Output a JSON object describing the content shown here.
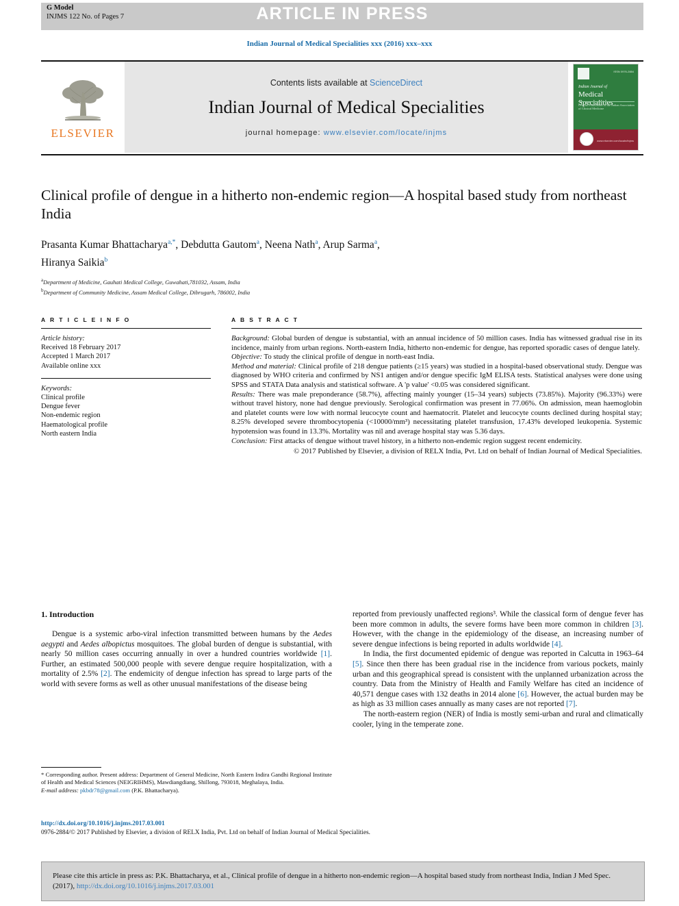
{
  "topbar": {
    "g_model": "G Model",
    "model_id": "INJMS 122 No. of Pages 7",
    "article_in_press": "ARTICLE IN PRESS"
  },
  "running_head": "Indian Journal of Medical Specialities xxx (2016) xxx–xxx",
  "masthead": {
    "publisher_name": "ELSEVIER",
    "contents_prefix": "Contents lists available at ",
    "contents_link": "ScienceDirect",
    "journal_title": "Indian Journal of Medical Specialities",
    "homepage_label": "journal homepage: ",
    "homepage_url": "www.elsevier.com/locate/injms",
    "cover": {
      "small_title": "Indian Journal of",
      "large_title": "Medical Specialities",
      "subtitle": "Official Publication of the Indian Association of Clinical Medicine",
      "issn_text": "ISSN 0976-2884",
      "band_text": "www.elsevier.com/locate/injms"
    }
  },
  "article": {
    "title": "Clinical profile of dengue in a hitherto non-endemic region—A hospital based study from northeast India",
    "authors": [
      {
        "name": "Prasanta Kumar Bhattacharya",
        "marks": "a,*"
      },
      {
        "name": "Debdutta Gautom",
        "marks": "a"
      },
      {
        "name": "Neena Nath",
        "marks": "a"
      },
      {
        "name": "Arup Sarma",
        "marks": "a"
      },
      {
        "name": "Hiranya Saikia",
        "marks": "b"
      }
    ],
    "affiliations": [
      {
        "mark": "a",
        "text": "Department of Medicine, Gauhati Medical College, Guwahati,781032, Assam, India"
      },
      {
        "mark": "b",
        "text": "Department of Community Medicine, Assam Medical College, Dibrugarh, 786002, India"
      }
    ]
  },
  "article_info": {
    "heading": "A R T I C L E  I N F O",
    "history_label": "Article history:",
    "history": [
      "Received 18 February 2017",
      "Accepted 1 March 2017",
      "Available online xxx"
    ],
    "keywords_label": "Keywords:",
    "keywords": [
      "Clinical profile",
      "Dengue fever",
      "Non-endemic region",
      "Haematological profile",
      "North eastern India"
    ]
  },
  "abstract": {
    "heading": "A B S T R A C T",
    "background_label": "Background:",
    "background": " Global burden of dengue is substantial, with an annual incidence of 50 million cases. India has witnessed gradual rise in its incidence, mainly from urban regions. North-eastern India, hitherto non-endemic for dengue, has reported sporadic cases of dengue lately.",
    "objective_label": "Objective:",
    "objective": " To study the clinical profile of dengue in north-east India.",
    "method_label": "Method and material:",
    "method": " Clinical profile of 218 dengue patients (≥15 years) was studied in a hospital-based observational study. Dengue was diagnosed by WHO criteria and confirmed by NS1 antigen and/or dengue specific IgM ELISA tests. Statistical analyses were done using SPSS and STATA Data analysis and statistical software. A 'p value' <0.05 was considered significant.",
    "results_label": "Results:",
    "results": " There was male preponderance (58.7%), affecting mainly younger (15–34 years) subjects (73.85%). Majority (96.33%) were without travel history, none had dengue previously. Serological confirmation was present in 77.06%. On admission, mean haemoglobin and platelet counts were low with normal leucocyte count and haematocrit. Platelet and leucocyte counts declined during hospital stay; 8.25% developed severe thrombocytopenia (<10000/mm³) necessitating platelet transfusion, 17.43% developed leukopenia. Systemic hypotension was found in 13.3%. Mortality was nil and average hospital stay was 5.36 days.",
    "conclusion_label": "Conclusion:",
    "conclusion": " First attacks of dengue without travel history, in a hitherto non-endemic region suggest recent endemicity.",
    "copyright": "© 2017 Published by Elsevier, a division of RELX India, Pvt. Ltd on behalf of Indian Journal of Medical Specialities."
  },
  "body": {
    "section_heading": "1. Introduction",
    "left_paragraph": "Dengue is a systemic arbo-viral infection transmitted between humans by the Aedes aegypti and Aedes albopictus mosquitoes. The global burden of dengue is substantial, with nearly 50 million cases occurring annually in over a hundred countries worldwide [1]. Further, an estimated 500,000 people with severe dengue require hospitalization, with a mortality of 2.5% [2]. The endemicity of dengue infection has spread to large parts of the world with severe forms as well as other unusual manifestations of the disease being",
    "right_paragraph_1": "reported from previously unaffected regions³. While the classical form of dengue fever has been more common in adults, the severe forms have been more common in children [3]. However, with the change in the epidemiology of the disease, an increasing number of severe dengue infections is being reported in adults worldwide [4].",
    "right_paragraph_2": "In India, the first documented epidemic of dengue was reported in Calcutta in 1963–64 [5]. Since then there has been gradual rise in the incidence from various pockets, mainly urban and this geographical spread is consistent with the unplanned urbanization across the country. Data from the Ministry of Health and Family Welfare has cited an incidence of 40,571 dengue cases with 132 deaths in 2014 alone [6]. However, the actual burden may be as high as 33 million cases annually as many cases are not reported [7].",
    "right_paragraph_3": "The north-eastern region (NER) of India is mostly semi-urban and rural and climatically cooler, lying in the temperate zone."
  },
  "footnote": {
    "star": "*",
    "corresponding": " Corresponding author. Present address: Department of General Medicine, North Eastern Indira Gandhi Regional Institute of Health and Medical Sciences (NEIGRIHMS), Mawdiangdiang, Shillong, 793018, Meghalaya, India.",
    "email_label": "E-mail address:",
    "email": "pkbdr78@gmail.com",
    "email_owner": "(P.K. Bhattacharya)."
  },
  "doi": "http://dx.doi.org/10.1016/j.injms.2017.03.001",
  "issn_copyright": "0976-2884/© 2017 Published by Elsevier, a division of RELX India, Pvt. Ltd on behalf of Indian Journal of Medical Specialities.",
  "cite_box": {
    "text": "Please cite this article in press as: P.K. Bhattacharya, et al., Clinical profile of dengue in a hitherto non-endemic region—A hospital based study from northeast India, Indian J Med Spec. (2017), ",
    "link": "http://dx.doi.org/10.1016/j.injms.2017.03.001"
  },
  "colors": {
    "link_blue": "#1a6ca8",
    "sciencedirect_blue": "#3b7fbe",
    "elsevier_orange": "#E87722",
    "band_gray": "#c9c9c9",
    "cover_green": "#2f7d3f",
    "cover_red": "#8e2231"
  }
}
